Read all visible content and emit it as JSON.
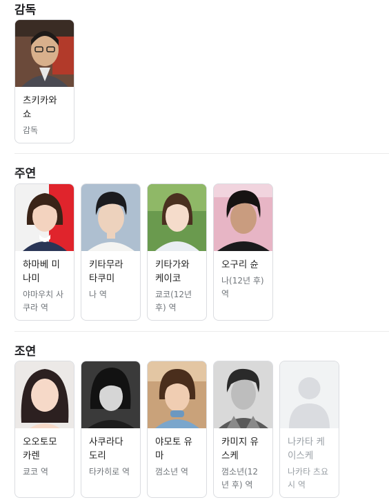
{
  "sections": [
    {
      "title": "감독",
      "people": [
        {
          "name": "츠키카와 쇼",
          "role": "감독",
          "photo": "photo-director"
        }
      ]
    },
    {
      "title": "주연",
      "people": [
        {
          "name": "하마베 미나미",
          "role": "야마우치 사쿠라 역",
          "photo": "photo-actress"
        },
        {
          "name": "키타무라 타쿠미",
          "role": "나 역",
          "photo": "photo-actor"
        },
        {
          "name": "키타가와 케이코",
          "role": "쿄코(12년 후) 역",
          "photo": "photo-actress"
        },
        {
          "name": "오구리 슌",
          "role": "나(12년 후) 역",
          "photo": "photo-actor"
        }
      ]
    },
    {
      "title": "조연",
      "people": [
        {
          "name": "오오토모 카렌",
          "role": "쿄코 역",
          "photo": "photo-actress"
        },
        {
          "name": "사쿠라다 도리",
          "role": "타카히로 역",
          "photo": "photo-actor"
        },
        {
          "name": "야모토 유마",
          "role": "껌소년 역",
          "photo": "photo-actor"
        },
        {
          "name": "카미지 유스케",
          "role": "껌소년(12년 후) 역",
          "photo": "photo-actor"
        },
        {
          "name": "나카타 케이스케",
          "role": "나카타 츠요시 역",
          "photo": "placeholder-avatar-icon"
        }
      ]
    }
  ]
}
